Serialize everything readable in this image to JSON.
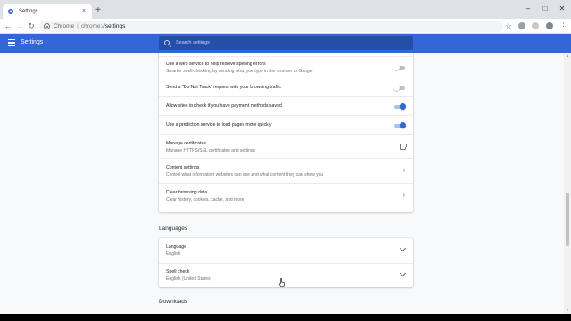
{
  "tab": {
    "title": "Settings",
    "close": "×",
    "new_tab": "+"
  },
  "window_controls": {
    "minimize": "–",
    "maximize": "□",
    "close": "✕"
  },
  "toolbar": {
    "back": "←",
    "forward": "→",
    "reload": "↻",
    "site_label": "Chrome",
    "url_scheme": "chrome://",
    "url_path": "settings",
    "star": "☆",
    "menu": "⋮"
  },
  "header": {
    "title": "Settings",
    "search_placeholder": "Search settings"
  },
  "privacy_rows": [
    {
      "label": "Use a web service to help resolve spelling errors",
      "sub": "Smarter spell-checking by sending what you type in the browser to Google",
      "control": "toggle",
      "on": false
    },
    {
      "label": "Send a \"Do Not Track\" request with your browsing traffic",
      "sub": "",
      "control": "toggle",
      "on": false
    },
    {
      "label": "Allow sites to check if you have payment methods saved",
      "sub": "",
      "control": "toggle",
      "on": true
    },
    {
      "label": "Use a prediction service to load pages more quickly",
      "sub": "",
      "control": "toggle",
      "on": true
    },
    {
      "label": "Manage certificates",
      "sub": "Manage HTTPS/SSL certificates and settings",
      "control": "external"
    },
    {
      "label": "Content settings",
      "sub": "Control what information websites can use and what content they can show you",
      "control": "arrow",
      "arrow": "›"
    },
    {
      "label": "Clear browsing data",
      "sub": "Clear history, cookies, cache, and more",
      "control": "arrow",
      "arrow": "›"
    }
  ],
  "languages": {
    "title": "Languages",
    "rows": [
      {
        "label": "Language",
        "sub": "English"
      },
      {
        "label": "Spell check",
        "sub": "English (United States)"
      }
    ]
  },
  "downloads": {
    "title": "Downloads"
  },
  "colors": {
    "accent": "#3367d6",
    "header_bg": "#3367d6"
  }
}
